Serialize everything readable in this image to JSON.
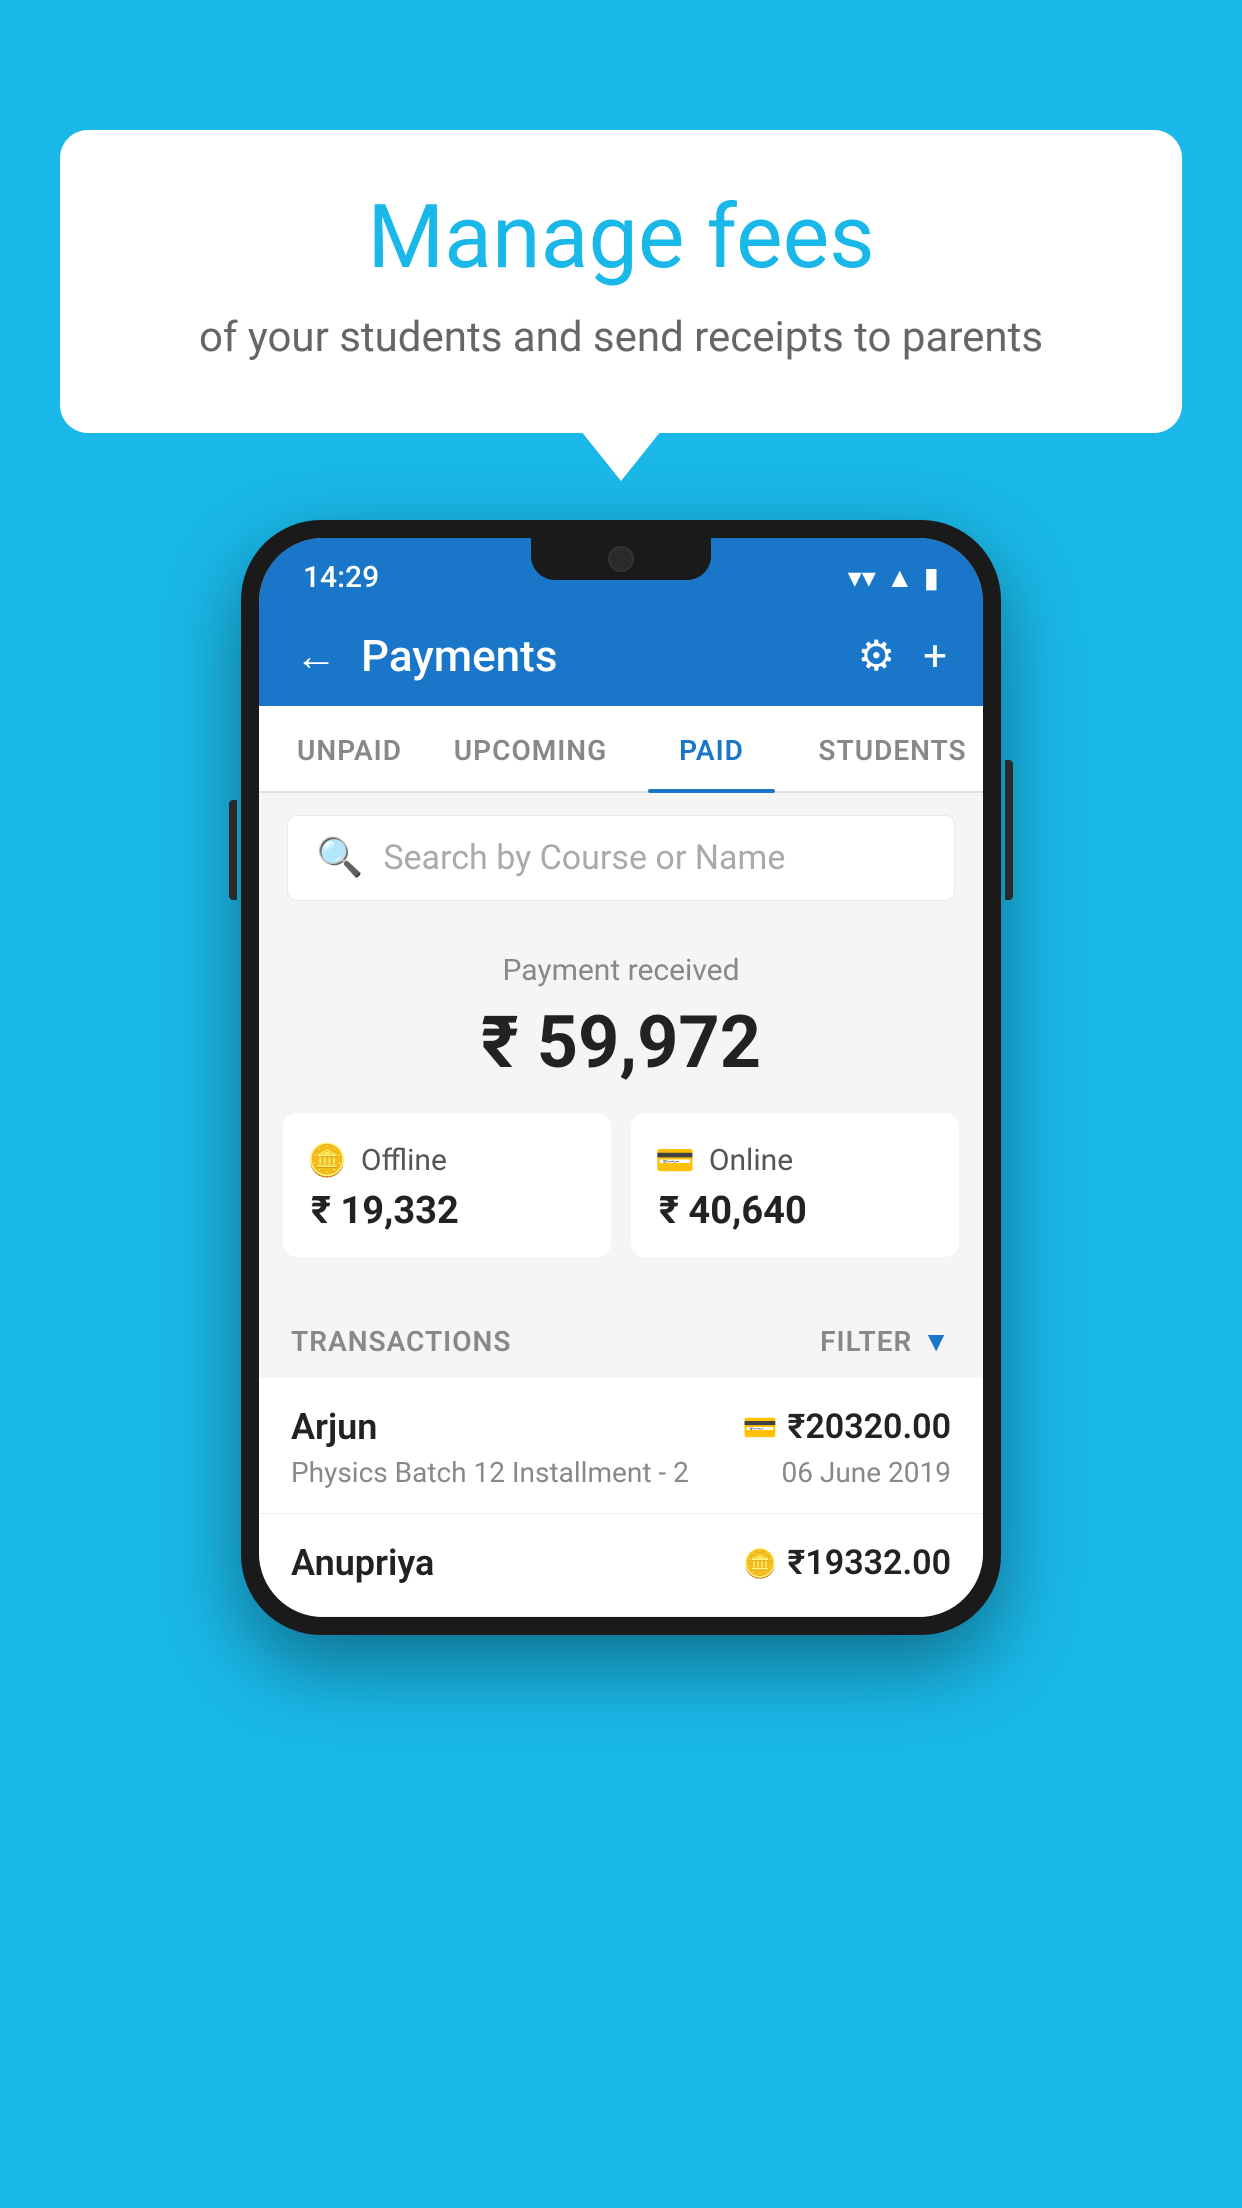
{
  "background_color": "#1ab8e8",
  "bubble": {
    "title": "Manage fees",
    "subtitle": "of your students and send receipts to parents"
  },
  "status_bar": {
    "time": "14:29",
    "wifi_icon": "▼",
    "signal_icon": "▲",
    "battery_icon": "▮"
  },
  "header": {
    "title": "Payments",
    "back_label": "←",
    "gear_label": "⚙",
    "plus_label": "+"
  },
  "tabs": [
    {
      "id": "unpaid",
      "label": "UNPAID",
      "active": false
    },
    {
      "id": "upcoming",
      "label": "UPCOMING",
      "active": false
    },
    {
      "id": "paid",
      "label": "PAID",
      "active": true
    },
    {
      "id": "students",
      "label": "STUDENTS",
      "active": false
    }
  ],
  "search": {
    "placeholder": "Search by Course or Name"
  },
  "payment_section": {
    "received_label": "Payment received",
    "total_amount": "₹ 59,972",
    "offline_label": "Offline",
    "offline_amount": "₹ 19,332",
    "online_label": "Online",
    "online_amount": "₹ 40,640"
  },
  "transactions": {
    "header_label": "TRANSACTIONS",
    "filter_label": "FILTER",
    "rows": [
      {
        "name": "Arjun",
        "course": "Physics Batch 12 Installment - 2",
        "amount": "₹20320.00",
        "date": "06 June 2019",
        "payment_type": "online"
      },
      {
        "name": "Anupriya",
        "course": "",
        "amount": "₹19332.00",
        "date": "",
        "payment_type": "offline"
      }
    ]
  }
}
